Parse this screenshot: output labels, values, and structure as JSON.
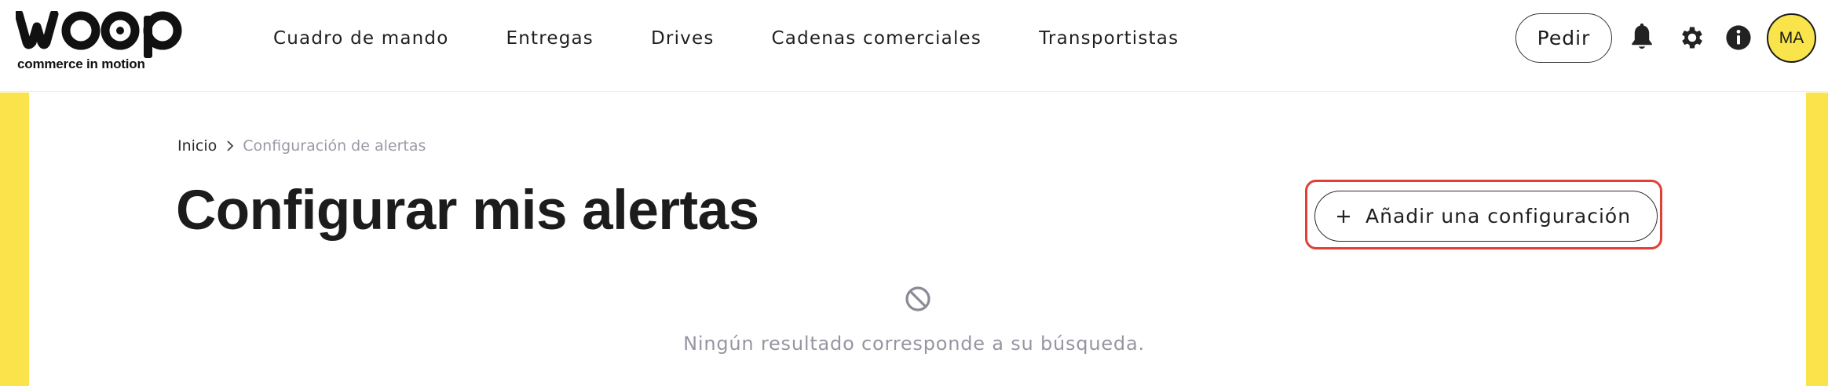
{
  "brand": {
    "name": "woop",
    "tagline": "commerce in motion"
  },
  "nav": {
    "items": [
      {
        "label": "Cuadro de mando"
      },
      {
        "label": "Entregas"
      },
      {
        "label": "Drives"
      },
      {
        "label": "Cadenas comerciales"
      },
      {
        "label": "Transportistas"
      }
    ]
  },
  "header": {
    "order_button": "Pedir",
    "icons": [
      "bell-icon",
      "gear-icon",
      "info-icon"
    ],
    "user_initials": "MA"
  },
  "breadcrumb": {
    "home": "Inicio",
    "current": "Configuración de alertas"
  },
  "main": {
    "title": "Configurar mis alertas",
    "add_button": "Añadir una configuración",
    "empty_message": "Ningún resultado corresponde a su búsqueda."
  },
  "colors": {
    "accent_yellow": "#fbe44b",
    "highlight_red": "#e04034",
    "muted_text": "#9696a2"
  }
}
